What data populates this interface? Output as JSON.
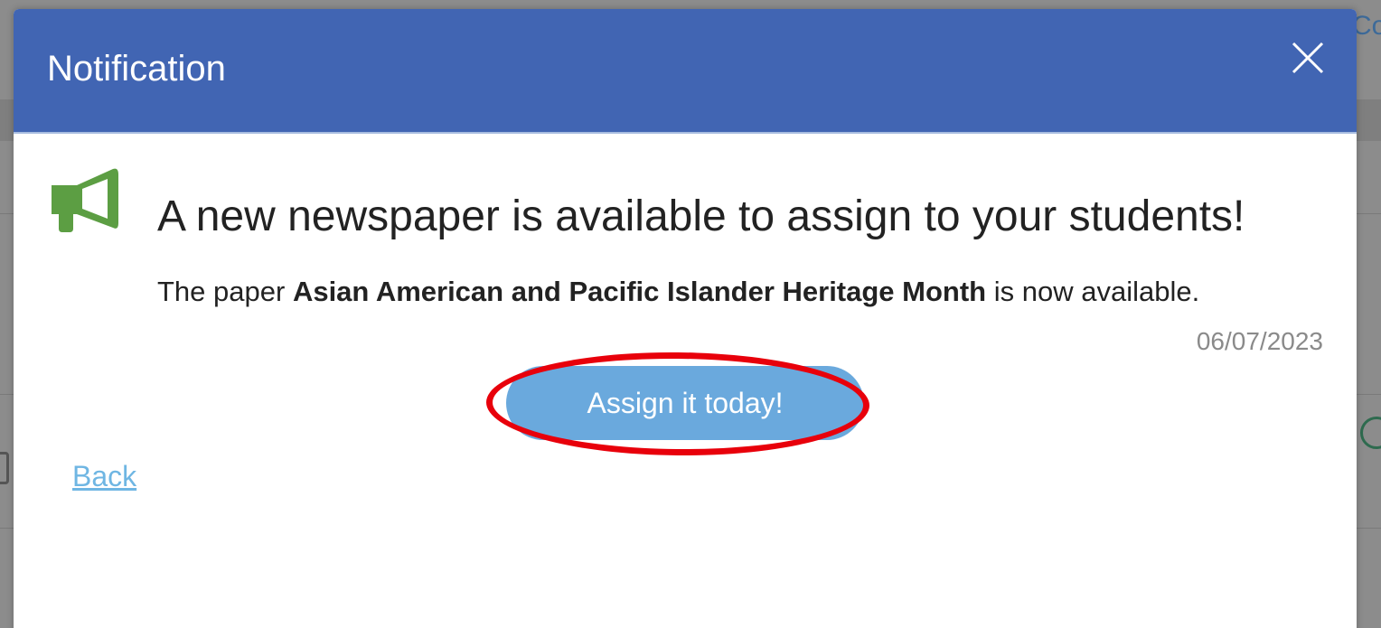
{
  "background": {
    "peek_text": "Co"
  },
  "modal": {
    "title": "Notification",
    "close_icon": "close-icon",
    "announcement_icon": "megaphone-icon",
    "headline": "A new newspaper is available to assign to your students!",
    "message_prefix": "The paper ",
    "paper_name": "Asian American and Pacific Islander Heritage Month",
    "message_suffix": " is now available.",
    "date": "06/07/2023",
    "assign_button_label": "Assign it today!",
    "back_link_label": "Back"
  },
  "colors": {
    "header_bg": "#4165b3",
    "button_bg": "#6aa9dd",
    "megaphone": "#5c9e43",
    "link": "#6fb6e3",
    "highlight_ring": "#e8000b"
  }
}
